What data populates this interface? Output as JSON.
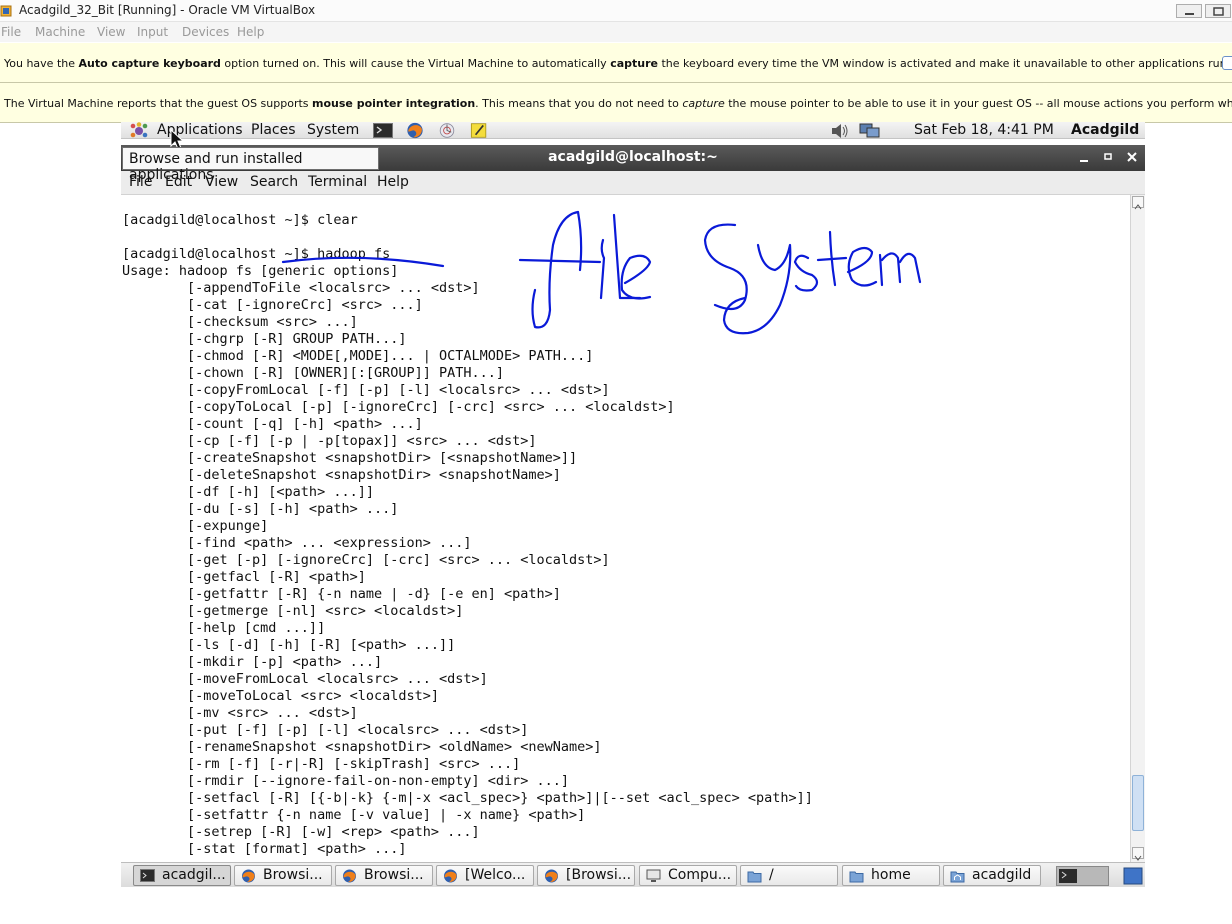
{
  "host": {
    "title": "Acadgild_32_Bit [Running] - Oracle VM VirtualBox",
    "menu": [
      "File",
      "Machine",
      "View",
      "Input",
      "Devices",
      "Help"
    ],
    "notice1": {
      "a": "You have the ",
      "b": "Auto capture keyboard",
      "c": " option turned on. This will cause the Virtual Machine to automatically ",
      "d": "capture",
      "e": " the keyboard every time the VM window is activated and make it unavailable to other applications running on your host machine:"
    },
    "notice2": {
      "a": "The Virtual Machine reports that the guest OS supports ",
      "b": "mouse pointer integration",
      "c": ". This means that you do not need to ",
      "d": "capture",
      "e": " the mouse pointer to be able to use it in your guest OS -- all mouse actions you perform when the mouse pointer is over"
    }
  },
  "panel": {
    "applications": "Applications",
    "places": "Places",
    "system": "System",
    "clock": "Sat Feb 18,  4:41 PM",
    "user": "Acadgild"
  },
  "tooltip": "Browse and run installed applications",
  "terminal": {
    "title": "acadgild@localhost:~",
    "menu": [
      "File",
      "Edit",
      "View",
      "Search",
      "Terminal",
      "Help"
    ],
    "lines": [
      "[acadgild@localhost ~]$ clear",
      "",
      "[acadgild@localhost ~]$ hadoop fs",
      "Usage: hadoop fs [generic options]",
      "        [-appendToFile <localsrc> ... <dst>]",
      "        [-cat [-ignoreCrc] <src> ...]",
      "        [-checksum <src> ...]",
      "        [-chgrp [-R] GROUP PATH...]",
      "        [-chmod [-R] <MODE[,MODE]... | OCTALMODE> PATH...]",
      "        [-chown [-R] [OWNER][:[GROUP]] PATH...]",
      "        [-copyFromLocal [-f] [-p] [-l] <localsrc> ... <dst>]",
      "        [-copyToLocal [-p] [-ignoreCrc] [-crc] <src> ... <localdst>]",
      "        [-count [-q] [-h] <path> ...]",
      "        [-cp [-f] [-p | -p[topax]] <src> ... <dst>]",
      "        [-createSnapshot <snapshotDir> [<snapshotName>]]",
      "        [-deleteSnapshot <snapshotDir> <snapshotName>]",
      "        [-df [-h] [<path> ...]]",
      "        [-du [-s] [-h] <path> ...]",
      "        [-expunge]",
      "        [-find <path> ... <expression> ...]",
      "        [-get [-p] [-ignoreCrc] [-crc] <src> ... <localdst>]",
      "        [-getfacl [-R] <path>]",
      "        [-getfattr [-R] {-n name | -d} [-e en] <path>]",
      "        [-getmerge [-nl] <src> <localdst>]",
      "        [-help [cmd ...]]",
      "        [-ls [-d] [-h] [-R] [<path> ...]]",
      "        [-mkdir [-p] <path> ...]",
      "        [-moveFromLocal <localsrc> ... <dst>]",
      "        [-moveToLocal <src> <localdst>]",
      "        [-mv <src> ... <dst>]",
      "        [-put [-f] [-p] [-l] <localsrc> ... <dst>]",
      "        [-renameSnapshot <snapshotDir> <oldName> <newName>]",
      "        [-rm [-f] [-r|-R] [-skipTrash] <src> ...]",
      "        [-rmdir [--ignore-fail-on-non-empty] <dir> ...]",
      "        [-setfacl [-R] [{-b|-k} {-m|-x <acl_spec>} <path>]|[--set <acl_spec> <path>]]",
      "        [-setfattr {-n name [-v value] | -x name} <path>]",
      "        [-setrep [-R] [-w] <rep> <path> ...]",
      "        [-stat [format] <path> ...]"
    ]
  },
  "annotation": {
    "text": "file system",
    "color": "#0a1ad8"
  },
  "taskbar": [
    {
      "label": "acadgil...",
      "icon": "terminal-icon"
    },
    {
      "label": "Browsi...",
      "icon": "firefox-icon"
    },
    {
      "label": "Browsi...",
      "icon": "firefox-icon"
    },
    {
      "label": "[Welco...",
      "icon": "firefox-icon"
    },
    {
      "label": "[Browsi...",
      "icon": "firefox-icon"
    },
    {
      "label": "Compu...",
      "icon": "computer-icon"
    },
    {
      "label": "/",
      "icon": "folder-icon"
    },
    {
      "label": "home",
      "icon": "folder-icon"
    },
    {
      "label": "acadgild",
      "icon": "home-folder-icon"
    }
  ],
  "colors": {
    "notice_bg": "#ffffe1",
    "terminal_title_bg": "#3f3f3f",
    "ink": "#0a1ad8"
  }
}
